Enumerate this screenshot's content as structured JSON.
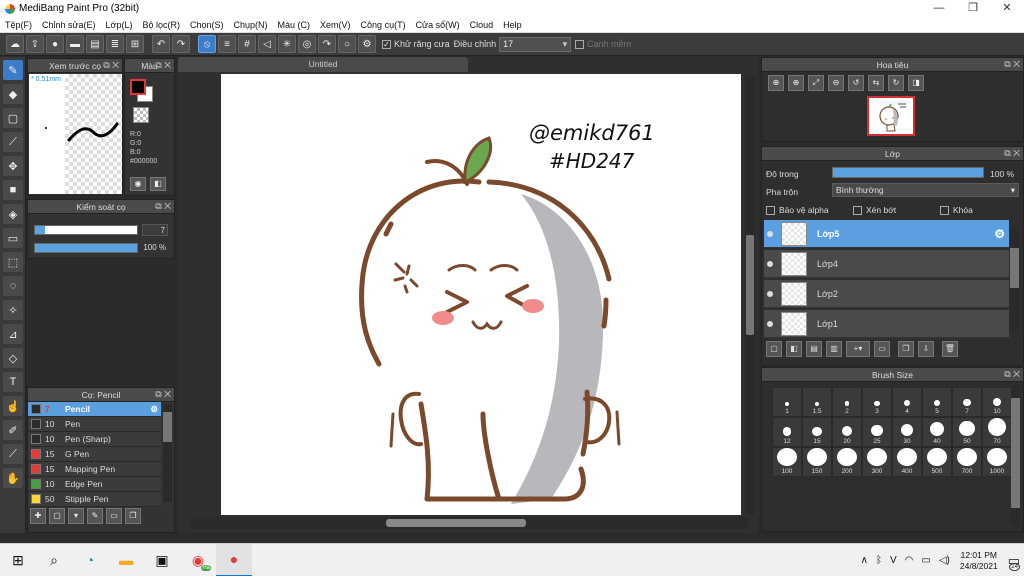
{
  "window": {
    "title": "MediBang Paint Pro (32bit)",
    "controls": {
      "minimize": "—",
      "maximize": "❐",
      "close": "✕"
    }
  },
  "menu": [
    "Tệp(F)",
    "Chỉnh sửa(E)",
    "Lớp(L)",
    "Bộ lọc(R)",
    "Chọn(S)",
    "Chụp(N)",
    "Màu (C)",
    "Xem(V)",
    "Công cụ(T)",
    "Cửa sổ(W)",
    "Cloud",
    "Help"
  ],
  "toolbar": {
    "antialias_label": "Khử răng cưa",
    "correction_label": "Điều chỉnh",
    "correction_value": "17",
    "soft_edge_label": "Cạnh mềm"
  },
  "brush_preview": {
    "title": "Xem trước cọ",
    "size_text": "* 0.51mm"
  },
  "color_panel": {
    "title": "Màu",
    "r": "R:0",
    "g": "G:0",
    "b": "B:0",
    "hex": "#000000",
    "fg": "#000000",
    "bg": "#ffffff"
  },
  "brush_control": {
    "title": "Kiểm soát cọ",
    "size_value": "7",
    "opacity_value": "100 %",
    "size_fraction": 0.1,
    "opacity_fraction": 1.0
  },
  "brush_list": {
    "title": "Cọ: Pencil",
    "items": [
      {
        "num": "7",
        "name": "Pencil",
        "color": "#2b2b2b",
        "selected": true
      },
      {
        "num": "10",
        "name": "Pen",
        "color": "#2b2b2b"
      },
      {
        "num": "10",
        "name": "Pen (Sharp)",
        "color": "#2b2b2b"
      },
      {
        "num": "15",
        "name": "G Pen",
        "color": "#e53935"
      },
      {
        "num": "15",
        "name": "Mapping Pen",
        "color": "#e53935"
      },
      {
        "num": "10",
        "name": "Edge Pen",
        "color": "#43a047"
      },
      {
        "num": "50",
        "name": "Stipple Pen",
        "color": "#fdd835"
      }
    ]
  },
  "document": {
    "tab": "Untitled",
    "signature_line1": "@emikd761",
    "signature_line2": "#HD247"
  },
  "navigator": {
    "title": "Hoa tiêu"
  },
  "layers": {
    "title": "Lớp",
    "opacity_label": "Độ trong",
    "opacity_value": "100 %",
    "opacity_fraction": 1.0,
    "blend_label": "Pha trộn",
    "blend_value": "Bình thường",
    "protect_alpha": "Bảo vệ alpha",
    "clipping": "Xén bớt",
    "lock": "Khóa",
    "items": [
      {
        "name": "Lớp5",
        "selected": true
      },
      {
        "name": "Lớp4"
      },
      {
        "name": "Lớp2"
      },
      {
        "name": "Lớp1"
      }
    ]
  },
  "brush_size": {
    "title": "Brush Size",
    "sizes": [
      "1",
      "1.5",
      "2",
      "3",
      "4",
      "5",
      "7",
      "10",
      "12",
      "15",
      "20",
      "25",
      "30",
      "40",
      "50",
      "70",
      "100",
      "150",
      "200",
      "300",
      "400",
      "500",
      "700",
      "1000"
    ]
  },
  "taskbar": {
    "time": "12:01 PM",
    "date": "24/8/2021",
    "notif_count": "24",
    "badge": "Hà"
  },
  "colors": {
    "accent": "#3d7cc9",
    "selection": "#5b9fe0",
    "character_outline": "#7b4a2d",
    "leaf": "#6aa84f",
    "cheek": "#f28c8c"
  }
}
